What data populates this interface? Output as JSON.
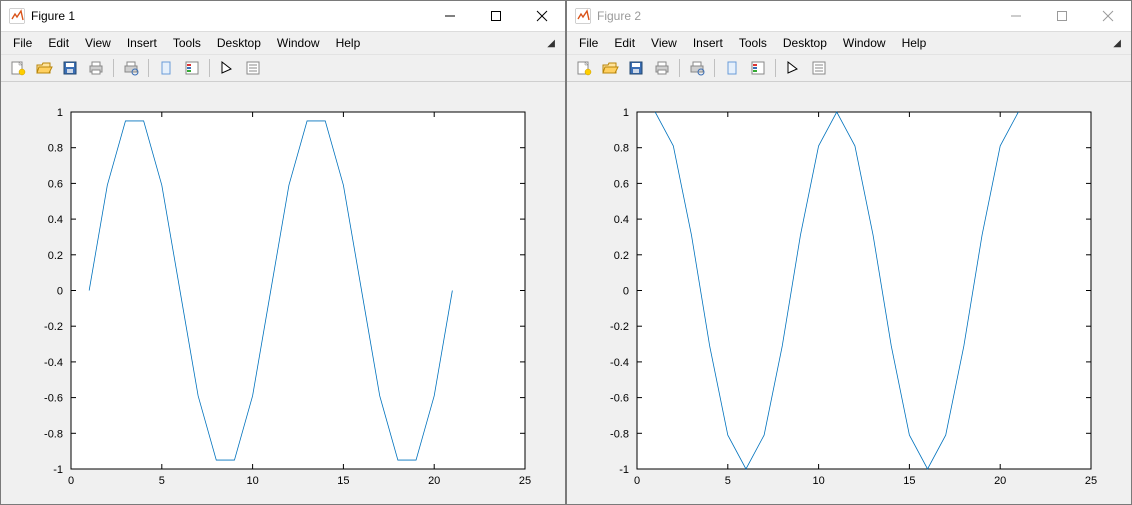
{
  "windows": [
    {
      "id": "fig1",
      "title": "Figure 1",
      "active": true
    },
    {
      "id": "fig2",
      "title": "Figure 2",
      "active": false
    }
  ],
  "menu": {
    "items": [
      "File",
      "Edit",
      "View",
      "Insert",
      "Tools",
      "Desktop",
      "Window",
      "Help"
    ]
  },
  "toolbar_icons": [
    "new",
    "open",
    "save",
    "print",
    "|",
    "print-preview",
    "|",
    "link",
    "legend",
    "|",
    "pointer",
    "data-cursor"
  ],
  "chart_data": [
    {
      "type": "line",
      "window": "fig1",
      "title": "",
      "xlabel": "",
      "ylabel": "",
      "xlim": [
        0,
        25
      ],
      "ylim": [
        -1,
        1
      ],
      "xticks": [
        0,
        5,
        10,
        15,
        20,
        25
      ],
      "yticks": [
        -1,
        -0.8,
        -0.6,
        -0.4,
        -0.2,
        0,
        0.2,
        0.4,
        0.6,
        0.8,
        1
      ],
      "x": [
        1,
        2,
        3,
        4,
        5,
        6,
        7,
        8,
        9,
        10,
        11,
        12,
        13,
        14,
        15,
        16,
        17,
        18,
        19,
        20,
        21
      ],
      "y": [
        0.0,
        0.59,
        0.95,
        0.95,
        0.59,
        0.0,
        -0.59,
        -0.95,
        -0.95,
        -0.59,
        0.0,
        0.59,
        0.95,
        0.95,
        0.59,
        0.0,
        -0.59,
        -0.95,
        -0.95,
        -0.59,
        0.0
      ]
    },
    {
      "type": "line",
      "window": "fig2",
      "title": "",
      "xlabel": "",
      "ylabel": "",
      "xlim": [
        0,
        25
      ],
      "ylim": [
        -1,
        1
      ],
      "xticks": [
        0,
        5,
        10,
        15,
        20,
        25
      ],
      "yticks": [
        -1,
        -0.8,
        -0.6,
        -0.4,
        -0.2,
        0,
        0.2,
        0.4,
        0.6,
        0.8,
        1
      ],
      "x": [
        1,
        2,
        3,
        4,
        5,
        6,
        7,
        8,
        9,
        10,
        11,
        12,
        13,
        14,
        15,
        16,
        17,
        18,
        19,
        20,
        21
      ],
      "y": [
        1.0,
        0.81,
        0.31,
        -0.31,
        -0.81,
        -1.0,
        -0.81,
        -0.31,
        0.31,
        0.81,
        1.0,
        0.81,
        0.31,
        -0.31,
        -0.81,
        -1.0,
        -0.81,
        -0.31,
        0.31,
        0.81,
        1.0
      ]
    }
  ]
}
